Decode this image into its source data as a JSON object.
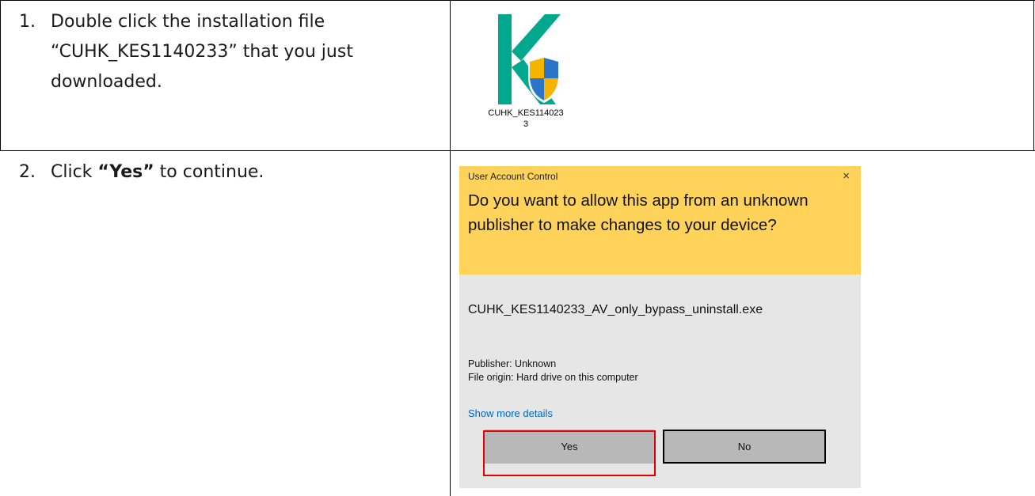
{
  "steps": [
    {
      "number": "1.",
      "lines": [
        "Double click the installation file",
        "“CUHK_KES1140233” that you just",
        "downloaded."
      ]
    },
    {
      "number": "2.",
      "prefix": "Click ",
      "emphasis": "“Yes”",
      "suffix": " to continue."
    }
  ],
  "file_icon": {
    "icon": "kaspersky-installer-icon",
    "label_line1": "CUHK_KES114023",
    "label_line2": "3"
  },
  "uac": {
    "title": "User Account Control",
    "close": "×",
    "question": "Do you want to allow this app from an unknown publisher to make changes to your device?",
    "file_name": "CUHK_KES1140233_AV_only_bypass_uninstall.exe",
    "publisher": "Publisher: Unknown",
    "origin": "File origin: Hard drive on this computer",
    "more_details": "Show more details",
    "yes_label": "Yes",
    "no_label": "No",
    "header_color": "#ffd35a",
    "body_color": "#e6e6e6",
    "highlight_color": "#e00000"
  }
}
